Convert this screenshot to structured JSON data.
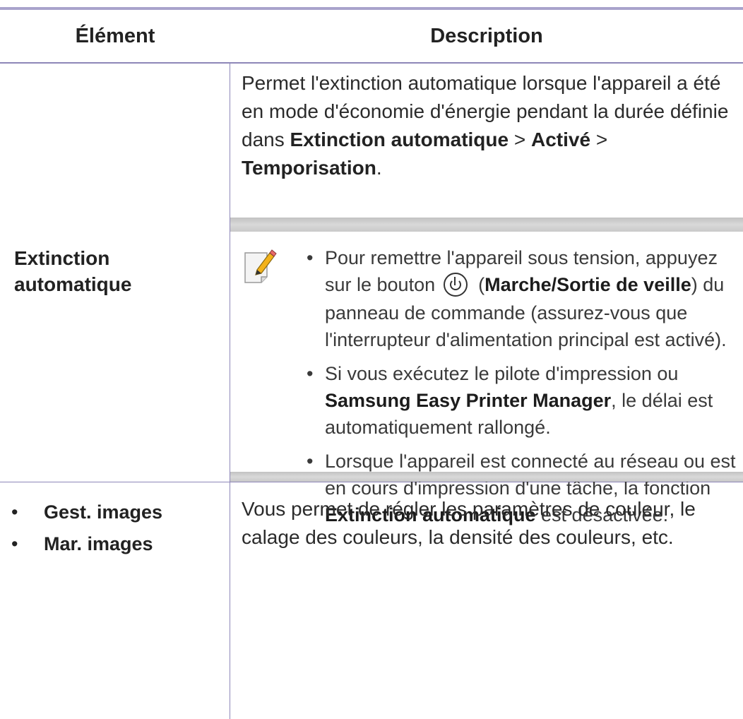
{
  "table": {
    "headers": {
      "element": "Élément",
      "description": "Description"
    },
    "row1": {
      "label_line1": "Extinction",
      "label_line2": "automatique",
      "desc": {
        "p1": "Permet l'extinction automatique lorsque l'appareil a été en mode d'économie d'énergie pendant la durée définie dans ",
        "b1": "Extinction automatique",
        "sep1": " > ",
        "b2": "Activé",
        "sep2": " > ",
        "b3": "Temporisation",
        "end": "."
      },
      "note": {
        "icon": "note-pencil-icon",
        "item1": {
          "t1": "Pour remettre l'appareil sous tension, appuyez sur le bouton ",
          "icon": "power-icon",
          "t2": " (",
          "b": "Marche/Sortie de veille",
          "t3": ") du panneau de commande (assurez-vous que l'interrupteur d'alimentation principal est activé)."
        },
        "item2": {
          "t1": "Si vous exécutez le pilote d'impression ou ",
          "b": "Samsung Easy Printer Manager",
          "t2": ", le délai est automatiquement rallongé."
        },
        "item3": {
          "t1": "Lorsque l'appareil est connecté au réseau ou est en cours d'impression d'une tâche, la fonction ",
          "b": "Extinction automatique",
          "t2": " est désactivée."
        }
      }
    },
    "row2": {
      "items": [
        "Gest. images",
        "Mar. images"
      ],
      "desc": "Vous permet de régler les paramètres de couleur, le calage des couleurs, la densité des couleurs, etc."
    },
    "bullet": "•"
  }
}
